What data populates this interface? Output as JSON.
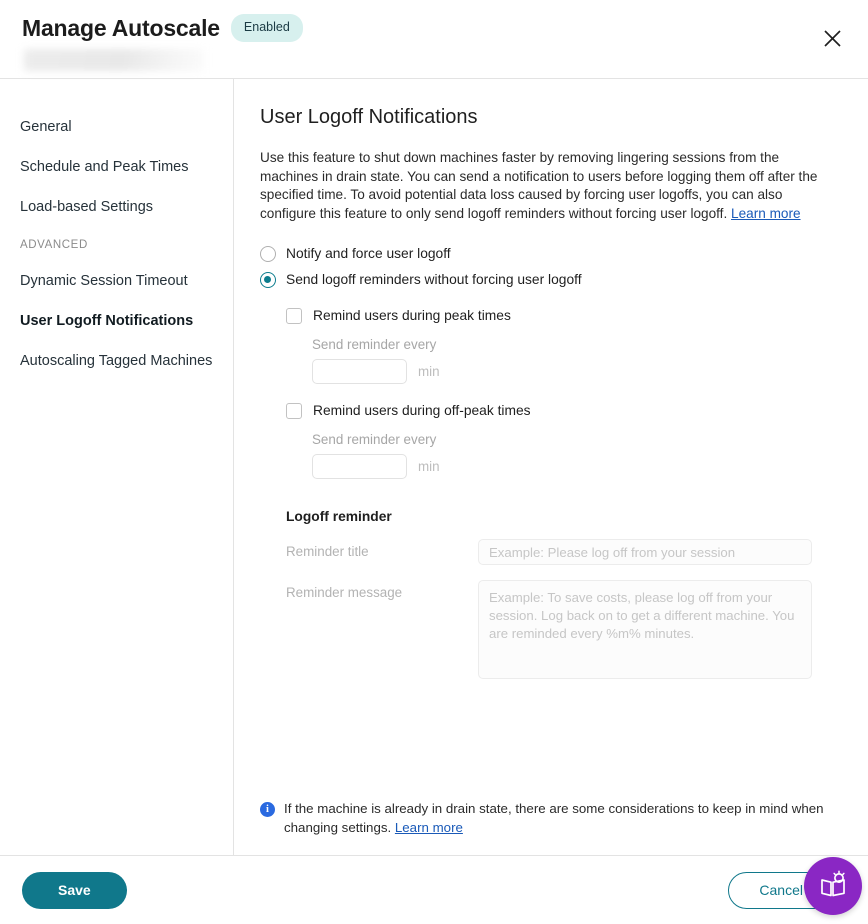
{
  "header": {
    "title": "Manage Autoscale",
    "status_badge": "Enabled",
    "close_label": "Close",
    "subtitle_redacted": ""
  },
  "sidebar": {
    "items": [
      {
        "label": "General",
        "selected": false
      },
      {
        "label": "Schedule and Peak Times",
        "selected": false
      },
      {
        "label": "Load-based Settings",
        "selected": false
      }
    ],
    "section_label": "ADVANCED",
    "advanced_items": [
      {
        "label": "Dynamic Session Timeout",
        "selected": false
      },
      {
        "label": "User Logoff Notifications",
        "selected": true
      },
      {
        "label": "Autoscaling Tagged Machines",
        "selected": false
      }
    ]
  },
  "main": {
    "title": "User Logoff Notifications",
    "description": "Use this feature to shut down machines faster by removing lingering sessions from the machines in drain state. You can send a notification to users before logging them off after the specified time. To avoid potential data loss caused by forcing user logoffs, you can also configure this feature to only send logoff reminders without forcing user logoff.",
    "description_link": "Learn more",
    "radios": [
      {
        "label": "Notify and force user logoff",
        "checked": false
      },
      {
        "label": "Send logoff reminders without forcing user logoff",
        "checked": true
      }
    ],
    "peak": {
      "checkbox_label": "Remind users during peak times",
      "checked": false,
      "interval_label": "Send reminder every",
      "interval_value": "",
      "unit": "min"
    },
    "offpeak": {
      "checkbox_label": "Remind users during off-peak times",
      "checked": false,
      "interval_label": "Send reminder every",
      "interval_value": "",
      "unit": "min"
    },
    "logoff_reminder": {
      "section_title": "Logoff reminder",
      "title_label": "Reminder title",
      "title_value": "",
      "title_placeholder": "Example: Please log off from your session",
      "message_label": "Reminder message",
      "message_value": "",
      "message_placeholder": "Example: To save costs, please log off from your session. Log back on to get a different machine. You are reminded every %m% minutes."
    },
    "info_note": {
      "text": "If the machine is already in drain state, there are some considerations to keep in mind when changing settings.",
      "link": "Learn more"
    }
  },
  "footer": {
    "save_label": "Save",
    "cancel_label": "Cancel",
    "help_label": "Guided help"
  },
  "colors": {
    "accent_teal": "#10788b",
    "badge_bg": "#d7f0ee",
    "link_blue": "#1a5ab8",
    "info_blue": "#2a6ae0",
    "fab_purple": "#8a27c4"
  }
}
